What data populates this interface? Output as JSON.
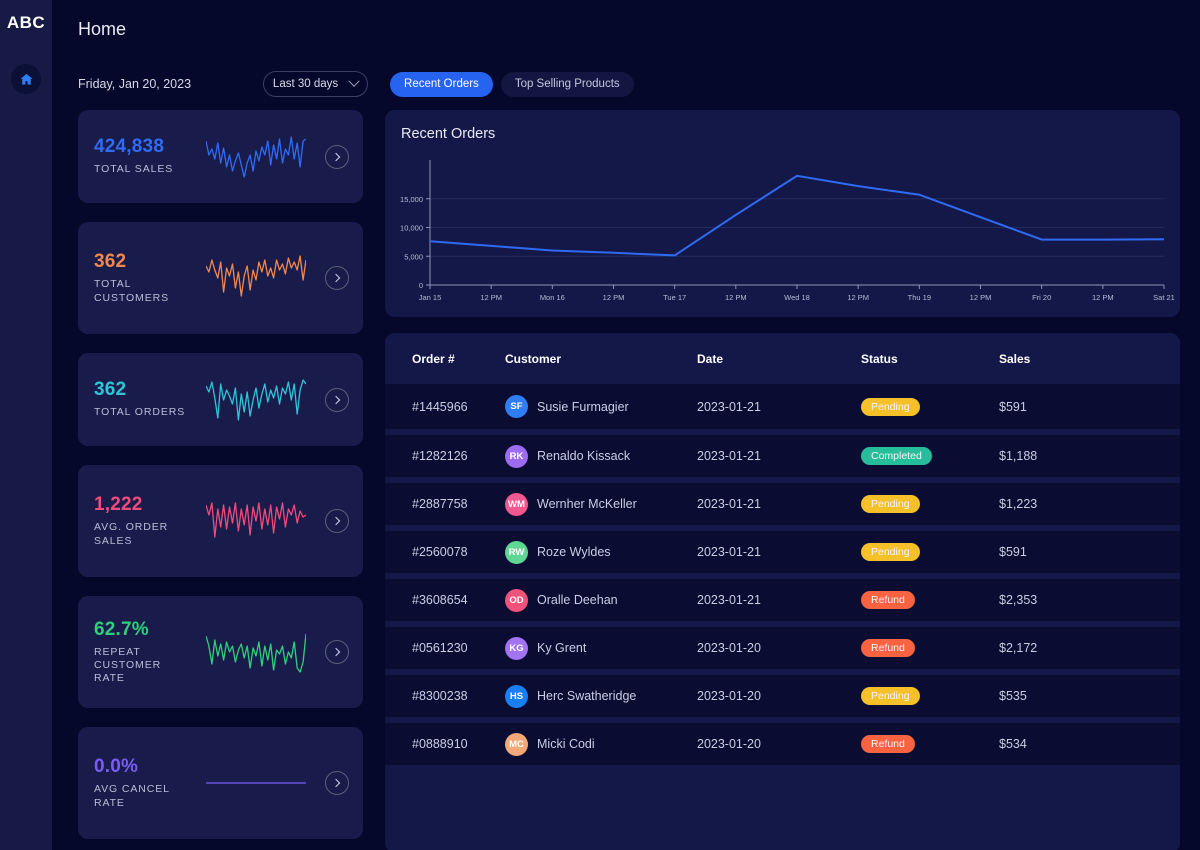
{
  "sidebar": {
    "logo": "ABC",
    "items": [
      {
        "name": "home",
        "icon": "home-icon",
        "active": true
      }
    ]
  },
  "header": {
    "title": "Home",
    "date_label": "Friday, Jan 20, 2023",
    "range_select": {
      "value": "Last 30 days",
      "icon": "chevron-down-icon"
    },
    "tabs": [
      {
        "label": "Recent Orders",
        "active": true
      },
      {
        "label": "Top Selling Products",
        "active": false
      }
    ]
  },
  "kpis": [
    {
      "value": "424,838",
      "label": "TOTAL SALES",
      "color": "#2f6bf5",
      "points": [
        44,
        30,
        36,
        26,
        42,
        22,
        37,
        18,
        30,
        14,
        24,
        32,
        20,
        8,
        22,
        30,
        14,
        34,
        24,
        38,
        30,
        44,
        20,
        40,
        26,
        46,
        22,
        36,
        30,
        48,
        26,
        42,
        18,
        44,
        46
      ],
      "arrow": "chevron-right-icon"
    },
    {
      "value": "362",
      "label": "TOTAL CUSTOMERS",
      "color": "#f0884f",
      "points": [
        40,
        34,
        46,
        36,
        28,
        44,
        14,
        38,
        30,
        42,
        18,
        34,
        10,
        30,
        40,
        16,
        36,
        26,
        44,
        34,
        46,
        30,
        38,
        28,
        46,
        36,
        42,
        32,
        48,
        38,
        44,
        36,
        50,
        26,
        46
      ],
      "arrow": "chevron-right-icon"
    },
    {
      "value": "362",
      "label": "TOTAL ORDERS",
      "color": "#2ec5d9",
      "points": [
        42,
        36,
        46,
        30,
        10,
        44,
        28,
        38,
        32,
        24,
        40,
        8,
        34,
        16,
        36,
        12,
        28,
        40,
        20,
        34,
        44,
        26,
        38,
        30,
        42,
        24,
        40,
        34,
        46,
        28,
        44,
        14,
        38,
        48,
        44
      ],
      "arrow": "chevron-right-icon"
    },
    {
      "value": "1,222",
      "label": "AVG. ORDER SALES",
      "color": "#ef4b7b",
      "points": [
        44,
        34,
        46,
        12,
        40,
        22,
        44,
        20,
        42,
        26,
        46,
        18,
        40,
        24,
        44,
        14,
        42,
        28,
        46,
        20,
        40,
        24,
        44,
        16,
        42,
        30,
        46,
        22,
        40,
        34,
        44,
        26,
        38,
        32,
        34
      ],
      "arrow": "chevron-right-icon"
    },
    {
      "value": "62.7%",
      "label": "REPEAT CUSTOMER RATE",
      "color": "#2fd07a",
      "points": [
        44,
        34,
        16,
        40,
        24,
        36,
        20,
        38,
        28,
        34,
        18,
        30,
        36,
        22,
        34,
        12,
        32,
        24,
        38,
        14,
        34,
        20,
        36,
        10,
        30,
        26,
        34,
        16,
        28,
        22,
        38,
        12,
        8,
        18,
        46
      ],
      "arrow": "chevron-right-icon"
    },
    {
      "value": "0.0%",
      "label": "AVG CANCEL RATE",
      "color": "#7a5bf5",
      "points": [
        28,
        28,
        28,
        28,
        28,
        28,
        28,
        28,
        28,
        28,
        28,
        28,
        28,
        28,
        28,
        28,
        28,
        28,
        28,
        28,
        28,
        28,
        28,
        28,
        28,
        28,
        28,
        28,
        28,
        28,
        28,
        28,
        28,
        28,
        28
      ],
      "arrow": "chevron-right-icon"
    }
  ],
  "chart_panel": {
    "title": "Recent Orders"
  },
  "chart_data": {
    "type": "line",
    "title": "Recent Orders",
    "xlabel": "",
    "ylabel": "",
    "ylim": [
      0,
      20000
    ],
    "yticks": [
      "0",
      "5,000",
      "10,000",
      "15,000"
    ],
    "ytick_values": [
      0,
      5000,
      10000,
      15000
    ],
    "xticks": [
      "Jan 15",
      "12 PM",
      "Mon 16",
      "12 PM",
      "Tue 17",
      "12 PM",
      "Wed 18",
      "12 PM",
      "Thu 19",
      "12 PM",
      "Fri 20",
      "12 PM",
      "Sat 21"
    ],
    "x": [
      0,
      1,
      2,
      3,
      4,
      5,
      6,
      7,
      8,
      9,
      10,
      11,
      12
    ],
    "values": [
      7600,
      6800,
      6000,
      5600,
      5150,
      12200,
      19000,
      17200,
      15700,
      11800,
      7900,
      7900,
      7950
    ],
    "series_color": "#2f6bf5",
    "grid": true,
    "legend": "none"
  },
  "table": {
    "columns": [
      "Order #",
      "Customer",
      "Date",
      "Status",
      "Sales"
    ],
    "rows": [
      {
        "order": "#1445966",
        "initials": "SF",
        "avatar_color": "#2f7ef5",
        "customer": "Susie Furmagier",
        "date": "2023-01-21",
        "status": "Pending",
        "status_color": "#f5c028",
        "sales": "$591"
      },
      {
        "order": "#1282126",
        "initials": "RK",
        "avatar_color": "#9d6bf0",
        "customer": "Renaldo Kissack",
        "date": "2023-01-21",
        "status": "Completed",
        "status_color": "#28bd9a",
        "sales": "$1,188"
      },
      {
        "order": "#2887758",
        "initials": "WM",
        "avatar_color": "#f0588f",
        "customer": "Wernher McKeller",
        "date": "2023-01-21",
        "status": "Pending",
        "status_color": "#f5c028",
        "sales": "$1,223"
      },
      {
        "order": "#2560078",
        "initials": "RW",
        "avatar_color": "#5fd694",
        "customer": "Roze Wyldes",
        "date": "2023-01-21",
        "status": "Pending",
        "status_color": "#f5c028",
        "sales": "$591"
      },
      {
        "order": "#3608654",
        "initials": "OD",
        "avatar_color": "#f0527c",
        "customer": "Oralle Deehan",
        "date": "2023-01-21",
        "status": "Refund",
        "status_color": "#f9633f",
        "sales": "$2,353"
      },
      {
        "order": "#0561230",
        "initials": "KG",
        "avatar_color": "#a373f2",
        "customer": "Ky Grent",
        "date": "2023-01-20",
        "status": "Refund",
        "status_color": "#f9633f",
        "sales": "$2,172"
      },
      {
        "order": "#8300238",
        "initials": "HS",
        "avatar_color": "#1a7ef5",
        "customer": "Herc Swatheridge",
        "date": "2023-01-20",
        "status": "Pending",
        "status_color": "#f5c028",
        "sales": "$535"
      },
      {
        "order": "#0888910",
        "initials": "MC",
        "avatar_color": "#f2a878",
        "customer": "Micki Codi",
        "date": "2023-01-20",
        "status": "Refund",
        "status_color": "#f9633f",
        "sales": "$534"
      }
    ]
  }
}
